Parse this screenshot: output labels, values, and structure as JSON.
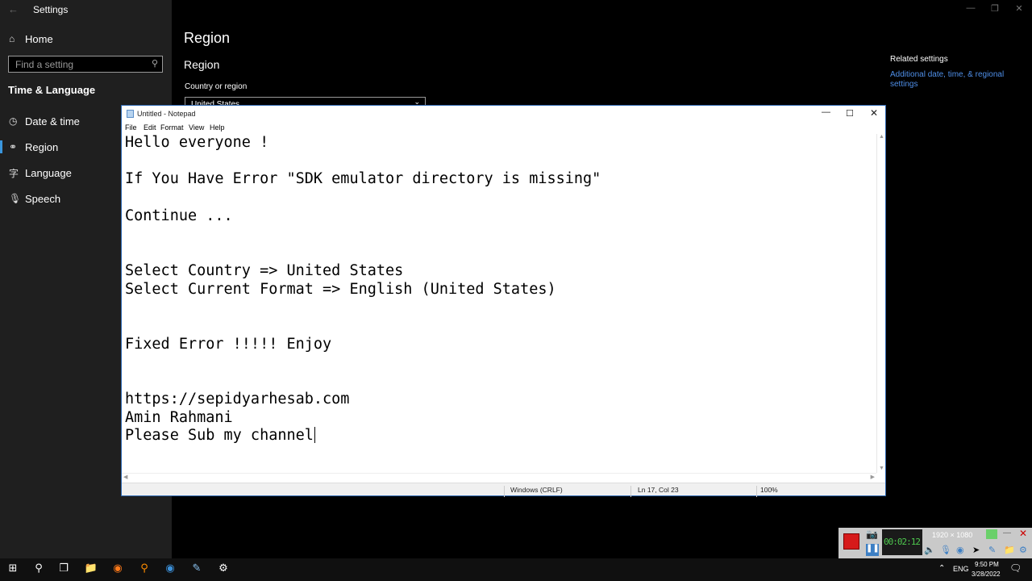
{
  "settings": {
    "window_title": "Settings",
    "home_label": "Home",
    "search_placeholder": "Find a setting",
    "section_title": "Time & Language",
    "nav": [
      {
        "label": "Date & time",
        "icon": "calendar-clock-icon"
      },
      {
        "label": "Region",
        "icon": "globe-icon"
      },
      {
        "label": "Language",
        "icon": "language-icon"
      },
      {
        "label": "Speech",
        "icon": "microphone-icon"
      }
    ],
    "page_title": "Region",
    "section_heading": "Region",
    "country_label": "Country or region",
    "country_value": "United States",
    "related_title": "Related settings",
    "related_link": "Additional date, time, & regional settings"
  },
  "notepad": {
    "title": "Untitled - Notepad",
    "menu": [
      "File",
      "Edit",
      "Format",
      "View",
      "Help"
    ],
    "text": "Hello everyone !\n\nIf You Have Error \"SDK emulator directory is missing\"\n\nContinue ...\n\n\nSelect Country => United States\nSelect Current Format => English (United States)\n\n\nFixed Error !!!!! Enjoy\n\n\nhttps://sepidyarhesab.com\nAmin Rahmani\nPlease Sub my channel ",
    "status": {
      "encoding": "Windows (CRLF)",
      "position": "Ln 17, Col 23",
      "zoom": "100%"
    }
  },
  "recorder": {
    "timer": "00:02:12",
    "resolution": "1920 × 1080"
  },
  "taskbar": {
    "language": "ENG",
    "time": "9:50 PM",
    "date": "3/28/2022"
  },
  "colors": {
    "accent": "#3a96dd",
    "link": "#4f8fe8",
    "notepad_border": "#2b66b0",
    "record_red": "#d61a1a"
  }
}
